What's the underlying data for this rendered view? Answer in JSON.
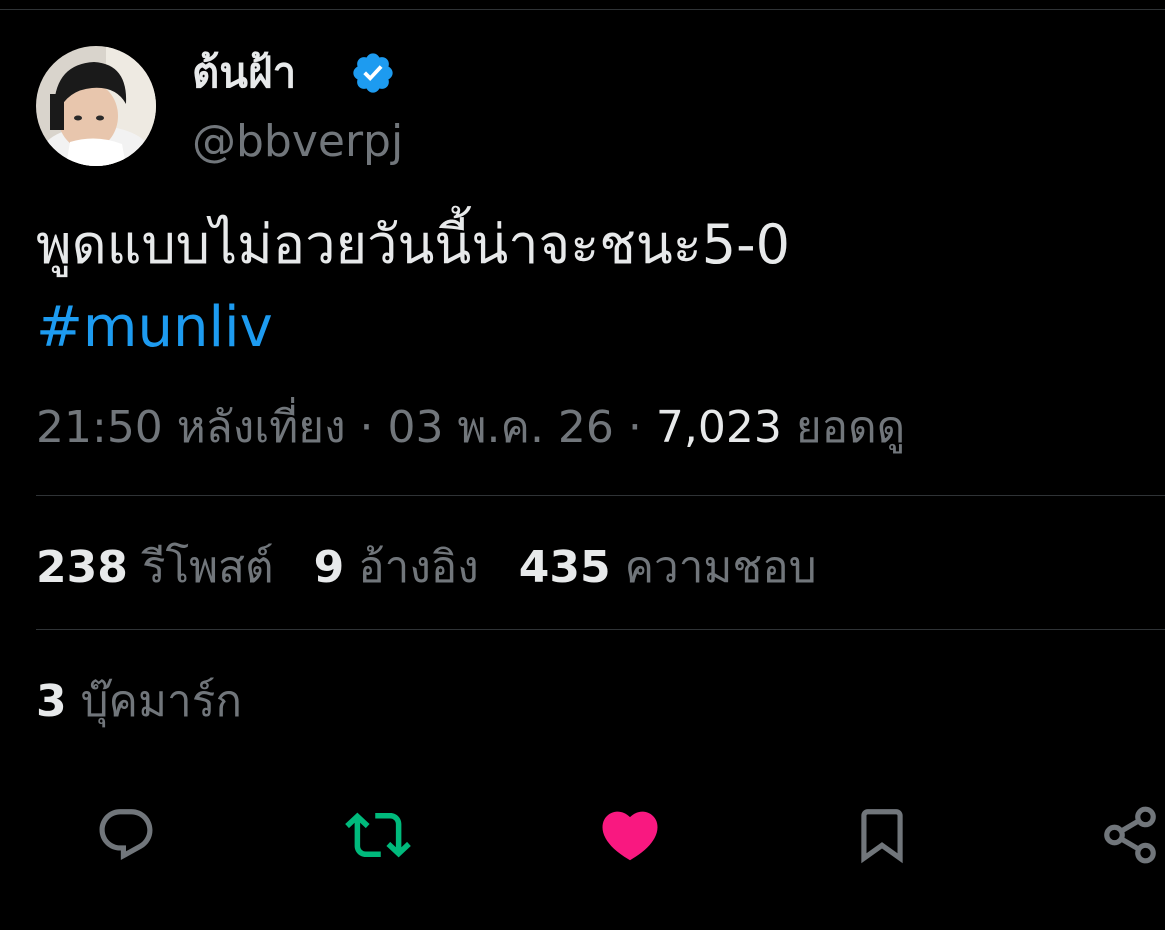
{
  "tweet": {
    "author": {
      "display_name": "ต้นฝ้า",
      "handle": "@bbverpj",
      "avatar_icon": "profile-photo",
      "verified_icon": "verified-badge-icon"
    },
    "text": "พูดแบบไม่อวยวันนี้น่าจะชนะ5-0",
    "hashtag": "#munliv",
    "timestamp": "21:50 หลังเที่ยง",
    "separator": "·",
    "date": "03 พ.ค. 26",
    "views_count": "7,023",
    "views_label": "ยอดดู"
  },
  "stats": {
    "retweets_count": "238",
    "retweets_label": "รีโพสต์",
    "quotes_count": "9",
    "quotes_label": "อ้างอิง",
    "likes_count": "435",
    "likes_label": "ความชอบ",
    "bookmarks_count": "3",
    "bookmarks_label": "บุ๊คมาร์ก"
  },
  "actions": [
    {
      "icon": "reply-icon"
    },
    {
      "icon": "retweet-icon"
    },
    {
      "icon": "like-icon"
    },
    {
      "icon": "bookmark-icon"
    },
    {
      "icon": "share-icon"
    }
  ],
  "colors": {
    "background": "#000000",
    "text_primary": "#e7e9ea",
    "text_secondary": "#71767b",
    "link": "#1d9bf0",
    "retweet_active": "#00ba7c",
    "like_active": "#f91880",
    "divider": "#2f3336"
  }
}
